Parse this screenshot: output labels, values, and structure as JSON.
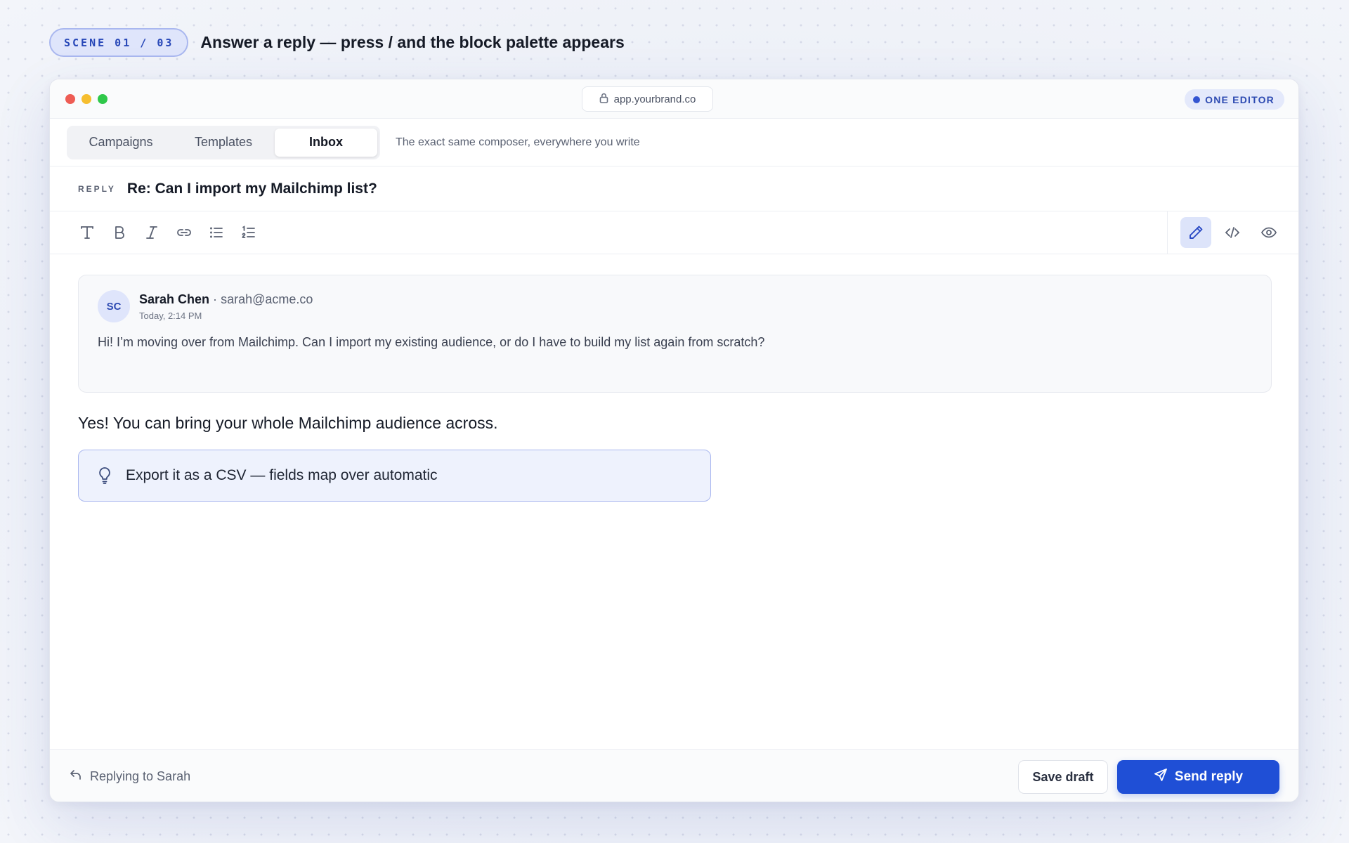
{
  "scene": {
    "label": "SCENE 01 / 03",
    "title": "Answer a reply — press / and the block palette appears"
  },
  "window": {
    "url": "app.yourbrand.co",
    "badge": "ONE EDITOR",
    "traffic_colors": [
      "#ee5c54",
      "#f6be2f",
      "#2fc84a"
    ]
  },
  "tabs": {
    "items": [
      {
        "label": "Campaigns",
        "active": false
      },
      {
        "label": "Templates",
        "active": false
      },
      {
        "label": "Inbox",
        "active": true
      }
    ],
    "caption": "The exact same composer, everywhere you write"
  },
  "subject": {
    "label": "REPLY",
    "text": "Re: Can I import my Mailchimp list?"
  },
  "toolbar": {
    "format_tools": [
      "text-icon",
      "bold-icon",
      "italic-icon",
      "link-icon",
      "bullet-list-icon",
      "numbered-list-icon"
    ],
    "modes": [
      {
        "icon": "pencil-icon",
        "active": true
      },
      {
        "icon": "code-icon",
        "active": false
      },
      {
        "icon": "eye-icon",
        "active": false
      }
    ]
  },
  "quoted_message": {
    "initials": "SC",
    "sender_name": "Sarah Chen",
    "separator": "·",
    "sender_email": "sarah@acme.co",
    "timestamp": "Today, 2:14 PM",
    "body": "Hi! I’m moving over from Mailchimp. Can I import my existing audience, or do I have to build my list again from scratch?"
  },
  "reply": {
    "text": "Yes! You can bring your whole Mailchimp audience across.",
    "callout": "Export it as a CSV — fields map over automatic"
  },
  "footer": {
    "replying_to": "Replying to Sarah",
    "save_label": "Save draft",
    "send_label": "Send reply"
  },
  "colors": {
    "accent": "#1f4fd6",
    "accent_soft": "#dde4fa"
  }
}
